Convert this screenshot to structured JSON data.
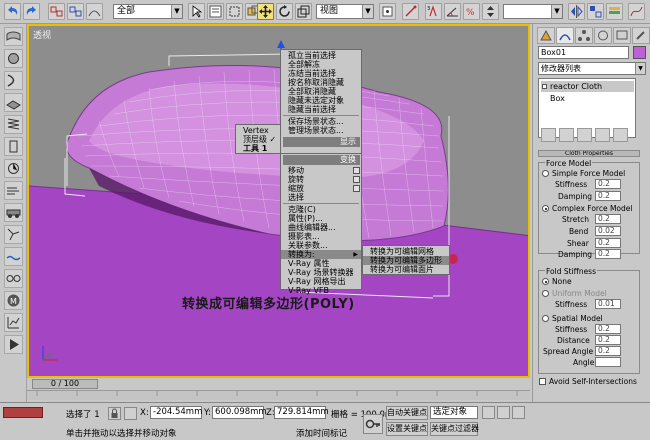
{
  "toolbar": {
    "selection_filter": "全部",
    "ref_coord": "视图"
  },
  "viewport": {
    "label": "透视",
    "caption": "转换成可编辑多边形(POLY)"
  },
  "quad_menu": {
    "top_items": [
      "孤立当前选择",
      "全部解冻",
      "冻结当前选择",
      "按名称取消隐藏",
      "全部取消隐藏",
      "隐藏未选定对象",
      "隐藏当前选择",
      "保存场景状态...",
      "管理场景状态..."
    ],
    "top_title": "显示",
    "bottom_title": "变换",
    "left_items": [
      "Vertex",
      "顶层级 ✓",
      "工具 1"
    ],
    "transform_items": [
      "移动",
      "旋转",
      "缩放",
      "选择",
      "克隆(C)",
      "属性(P)...",
      "曲线编辑器...",
      "摄影表...",
      "关联参数...",
      "转换为:",
      "V-Ray 属性",
      "V-Ray 场景转换器",
      "V-Ray 网格导出",
      "V-Ray VFB"
    ],
    "convert_arrow": "▶",
    "submenu": [
      "转换为可编辑网格",
      "转换为可编辑多边形",
      "转换为可编辑面片"
    ]
  },
  "right_panel": {
    "object_name": "Box01",
    "modifier_list": "修改器列表",
    "stack": [
      "reactor Cloth",
      "Box"
    ],
    "rollout_top": "Cloth Properties",
    "force_model_label": "Force Model",
    "simple_force": "Simple Force Model",
    "stiffness_label": "Stiffness",
    "stiffness_val": "0.2",
    "damping_label": "Damping",
    "damping_val": "0.2",
    "complex_force": "Complex Force Model",
    "stretch_label": "Stretch",
    "stretch_val": "0.2",
    "bend_label": "Bend",
    "bend_val": "0.02",
    "shear_label": "Shear",
    "shear_val": "0.2",
    "damping2_label": "Damping",
    "damping2_val": "0.2",
    "fold_label": "Fold Stiffness",
    "none_label": "None",
    "uniform_label": "Uniform Model",
    "uniform_stiff_label": "Stiffness",
    "uniform_stiff_val": "0.01",
    "spatial_label": "Spatial Model",
    "spatial_stiff_label": "Stiffness",
    "spatial_stiff_val": "0.2",
    "distance_label": "Distance",
    "distance_val": "0.2",
    "spread_label": "Spread Angle",
    "spread_val": "0.2",
    "angle_label": "Angle",
    "collisions_label": "Avoid Self-Intersections"
  },
  "timeline": {
    "slider": "0 / 100"
  },
  "status": {
    "selected": "选择了 1",
    "x_label": "X:",
    "x_val": "-204.54mm",
    "y_label": "Y:",
    "y_val": "600.098mm",
    "z_label": "Z:",
    "z_val": "729.814mm",
    "grid_label": "栅格 = 100.0mm",
    "auto_key": "自动关键点",
    "selected_obj": "选定对象",
    "set_key": "设置关键点",
    "key_filter": "关键点过滤器",
    "prompt": "单击并拖动以选择并移动对象",
    "add_tag": "添加时间标记"
  },
  "colors": {
    "viewport_bg": "#8d8d8d",
    "viewport_border": "#e8c000",
    "object_purple": "#c070d0",
    "floor_purple": "#a040c0"
  }
}
